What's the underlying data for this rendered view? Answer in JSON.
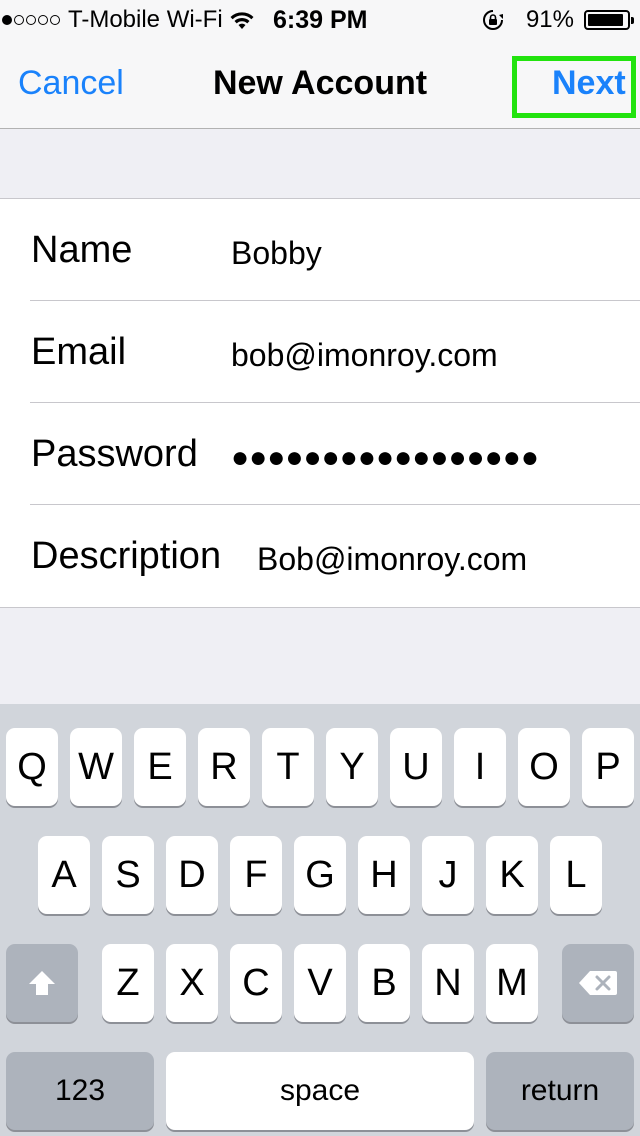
{
  "status_bar": {
    "signal_dots_filled": 1,
    "signal_dots_total": 5,
    "carrier": "T-Mobile Wi-Fi",
    "time": "6:39 PM",
    "battery_percent": "91%",
    "battery_level": 0.91
  },
  "nav": {
    "cancel_label": "Cancel",
    "title": "New Account",
    "next_label": "Next",
    "highlight_color": "#22e30e"
  },
  "form": {
    "fields": [
      {
        "label": "Name",
        "value": "Bobby"
      },
      {
        "label": "Email",
        "value": "bob@imonroy.com"
      },
      {
        "label": "Password",
        "value": "●●●●●●●●●●●●●●●●●"
      },
      {
        "label": "Description",
        "value": "Bob@imonroy.com"
      }
    ]
  },
  "keyboard": {
    "row1": [
      "Q",
      "W",
      "E",
      "R",
      "T",
      "Y",
      "U",
      "I",
      "O",
      "P"
    ],
    "row2": [
      "A",
      "S",
      "D",
      "F",
      "G",
      "H",
      "J",
      "K",
      "L"
    ],
    "row3": [
      "Z",
      "X",
      "C",
      "V",
      "B",
      "N",
      "M"
    ],
    "numbers_label": "123",
    "space_label": "space",
    "return_label": "return"
  },
  "colors": {
    "accent": "#1a82fb",
    "background": "#efeff4",
    "keyboard_bg": "#d1d5db"
  }
}
